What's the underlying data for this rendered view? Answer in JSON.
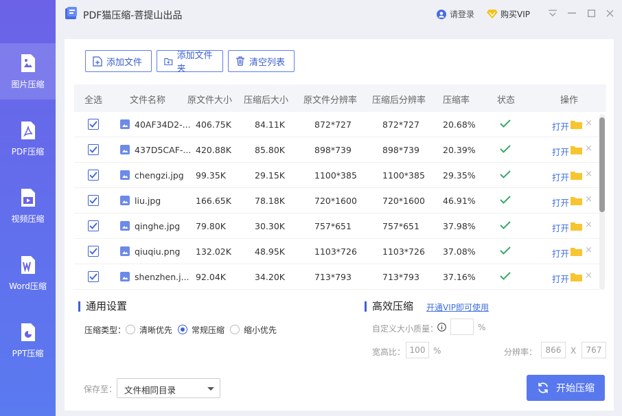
{
  "app": {
    "title": "PDF猫压缩-菩提山出品",
    "login": "请登录",
    "vip": "购买VIP"
  },
  "sidebar": {
    "items": [
      {
        "label": "图片压缩",
        "icon": "image-icon",
        "active": true
      },
      {
        "label": "PDF压缩",
        "icon": "pdf-icon",
        "active": false
      },
      {
        "label": "视频压缩",
        "icon": "video-icon",
        "active": false
      },
      {
        "label": "Word压缩",
        "icon": "word-icon",
        "active": false
      },
      {
        "label": "PPT压缩",
        "icon": "ppt-icon",
        "active": false
      }
    ]
  },
  "toolbar": {
    "add_file": "添加文件",
    "add_folder": "添加文件夹",
    "clear_list": "清空列表"
  },
  "table": {
    "headers": [
      "全选",
      "文件名称",
      "原文件大小",
      "压缩后大小",
      "原文件分辨率",
      "压缩后分辨率",
      "压缩率",
      "状态",
      "操作"
    ],
    "open_label": "打开",
    "rows": [
      {
        "name": "40AF34D2-...",
        "orig_size": "406.75K",
        "new_size": "84.11K",
        "orig_res": "872*727",
        "new_res": "872*727",
        "ratio": "20.68%"
      },
      {
        "name": "437D5CAF-...",
        "orig_size": "420.88K",
        "new_size": "85.80K",
        "orig_res": "898*739",
        "new_res": "898*739",
        "ratio": "20.39%"
      },
      {
        "name": "chengzi.jpg",
        "orig_size": "99.35K",
        "new_size": "29.15K",
        "orig_res": "1100*385",
        "new_res": "1100*385",
        "ratio": "29.35%"
      },
      {
        "name": "liu.jpg",
        "orig_size": "166.65K",
        "new_size": "78.18K",
        "orig_res": "720*1600",
        "new_res": "720*1600",
        "ratio": "46.91%"
      },
      {
        "name": "qinghe.jpg",
        "orig_size": "79.80K",
        "new_size": "30.30K",
        "orig_res": "757*651",
        "new_res": "757*651",
        "ratio": "37.98%"
      },
      {
        "name": "qiuqiu.png",
        "orig_size": "132.02K",
        "new_size": "48.95K",
        "orig_res": "1103*726",
        "new_res": "1103*726",
        "ratio": "37.08%"
      },
      {
        "name": "shenzhen.j...",
        "orig_size": "92.04K",
        "new_size": "34.20K",
        "orig_res": "713*793",
        "new_res": "713*793",
        "ratio": "37.16%"
      }
    ]
  },
  "general": {
    "title": "通用设置",
    "mode_label": "压缩类型：",
    "modes": [
      "清晰优先",
      "常规压缩",
      "缩小优先"
    ],
    "selected_mode": "常规压缩"
  },
  "advanced": {
    "title": "高效压缩",
    "vip_link": "开通VIP即可使用",
    "custom_size_label": "自定义大小质量：",
    "custom_size_unit": "%",
    "aspect_label": "宽高比：",
    "aspect_value": "100",
    "aspect_unit": "%",
    "resolution_label": "分辨率：",
    "res_w": "866",
    "res_x": "X",
    "res_h": "767"
  },
  "footer": {
    "save_label": "保存至：",
    "save_target": "文件相同目录",
    "start_button": "开始压缩"
  },
  "colors": {
    "accent": "#5878ee",
    "sidebar": "#6b62e8",
    "ok": "#3aa76d",
    "folder": "#f7c530"
  }
}
